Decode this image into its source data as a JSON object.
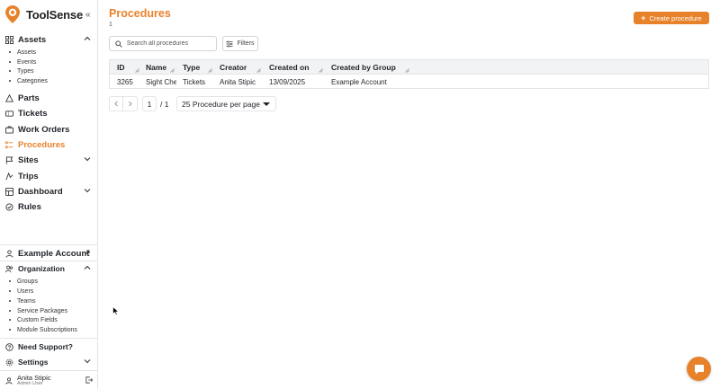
{
  "brand": {
    "name": "ToolSense",
    "accent": "#e8822a"
  },
  "sidebar": {
    "assets": {
      "label": "Assets",
      "subitems": [
        "Assets",
        "Events",
        "Types",
        "Categories"
      ]
    },
    "items": [
      {
        "label": "Parts",
        "icon": "parts-icon"
      },
      {
        "label": "Tickets",
        "icon": "ticket-icon"
      },
      {
        "label": "Work Orders",
        "icon": "briefcase-icon"
      },
      {
        "label": "Procedures",
        "icon": "list-icon",
        "active": true
      },
      {
        "label": "Sites",
        "icon": "flag-icon"
      },
      {
        "label": "Trips",
        "icon": "trips-icon"
      },
      {
        "label": "Dashboard",
        "icon": "dashboard-icon"
      },
      {
        "label": "Rules",
        "icon": "rules-icon"
      }
    ],
    "account": {
      "label": "Example Account"
    },
    "organization": {
      "label": "Organization",
      "subitems": [
        "Groups",
        "Users",
        "Teams",
        "Service Packages",
        "Custom Fields",
        "Module Subscriptions"
      ]
    },
    "support": {
      "label": "Need Support?"
    },
    "settings": {
      "label": "Settings"
    },
    "user": {
      "name": "Anita Stipic",
      "role": "Admin User"
    }
  },
  "main": {
    "title": "Procedures",
    "count": "1",
    "create_label": "Create procedure",
    "search_placeholder": "Search all procedures",
    "filters_label": "Filters",
    "table": {
      "columns": [
        "ID",
        "Name",
        "Type",
        "Creator",
        "Created on",
        "Created by Group"
      ],
      "rows": [
        [
          "3265",
          "Sight Che",
          "Tickets",
          "Anita Stipic",
          "13/09/2025",
          "Example Account"
        ]
      ]
    },
    "pagination": {
      "current_page": "1",
      "total": "/ 1",
      "per_page": "25 Procedure per page"
    }
  }
}
